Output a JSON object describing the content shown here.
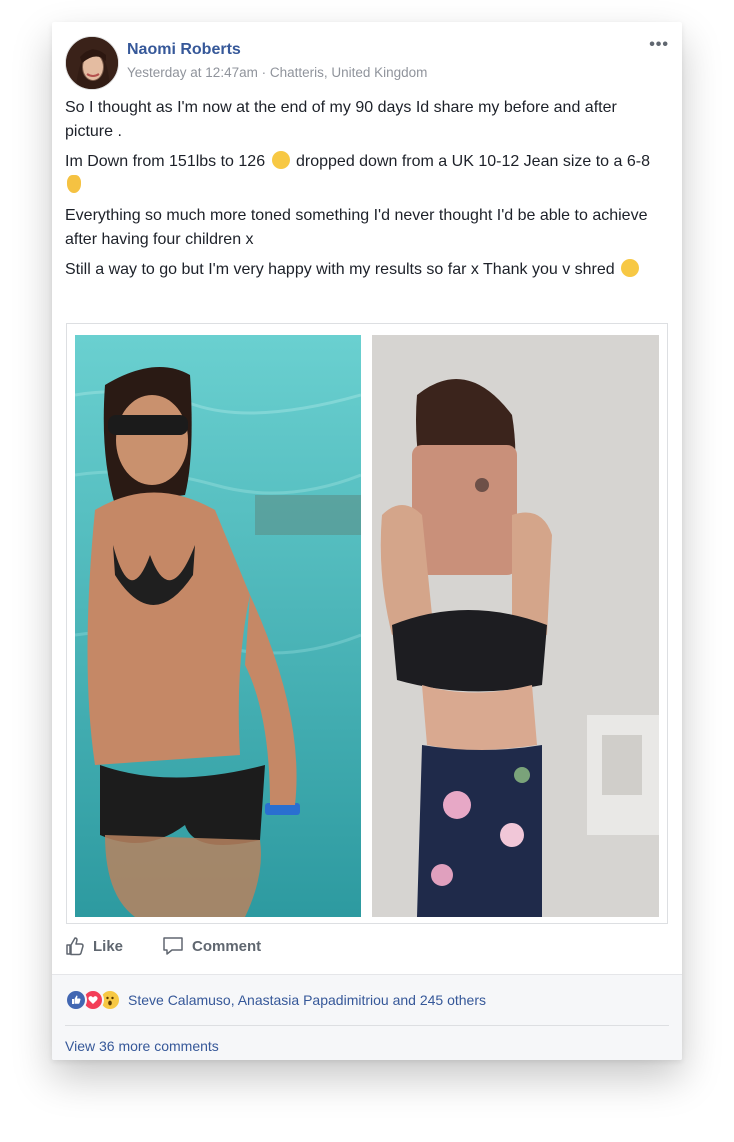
{
  "post": {
    "author": "Naomi Roberts",
    "timestamp": "Yesterday at 12:47am",
    "separator": " · ",
    "location": "Chatteris, United Kingdom",
    "menu_label": "•••",
    "paragraphs": [
      {
        "text": "So I thought as I'm now at the end of my 90 days Id share my before and after picture ."
      },
      {
        "text_a": "Im Down from 151lbs to 126 ",
        "emoji_a": "smiling-face-with-open-hands",
        "text_b": " dropped down from a UK 10-12 Jean size to a 6-8 ",
        "emoji_b": "ok-hand"
      },
      {
        "text": "Everything so much more toned something I'd never thought I'd be able to achieve after having four children x"
      },
      {
        "text_a": "Still a way to go but I'm very happy with my results so far x Thank you v shred ",
        "emoji_a": "smiling-face-with-open-hands"
      }
    ]
  },
  "actions": {
    "like_label": "Like",
    "comment_label": "Comment"
  },
  "reactions": {
    "icons": [
      "like-reaction-icon",
      "love-reaction-icon",
      "wow-reaction-icon"
    ],
    "summary": "Steve Calamuso, Anastasia Papadimitriou and 245 others"
  },
  "comments": {
    "view_more": "View 36 more comments"
  },
  "colors": {
    "link": "#365899",
    "text": "#1d2129",
    "meta": "#90949c",
    "like_blue": "#4267b2",
    "love_red": "#f33e58",
    "wow_yellow": "#f7c844"
  }
}
